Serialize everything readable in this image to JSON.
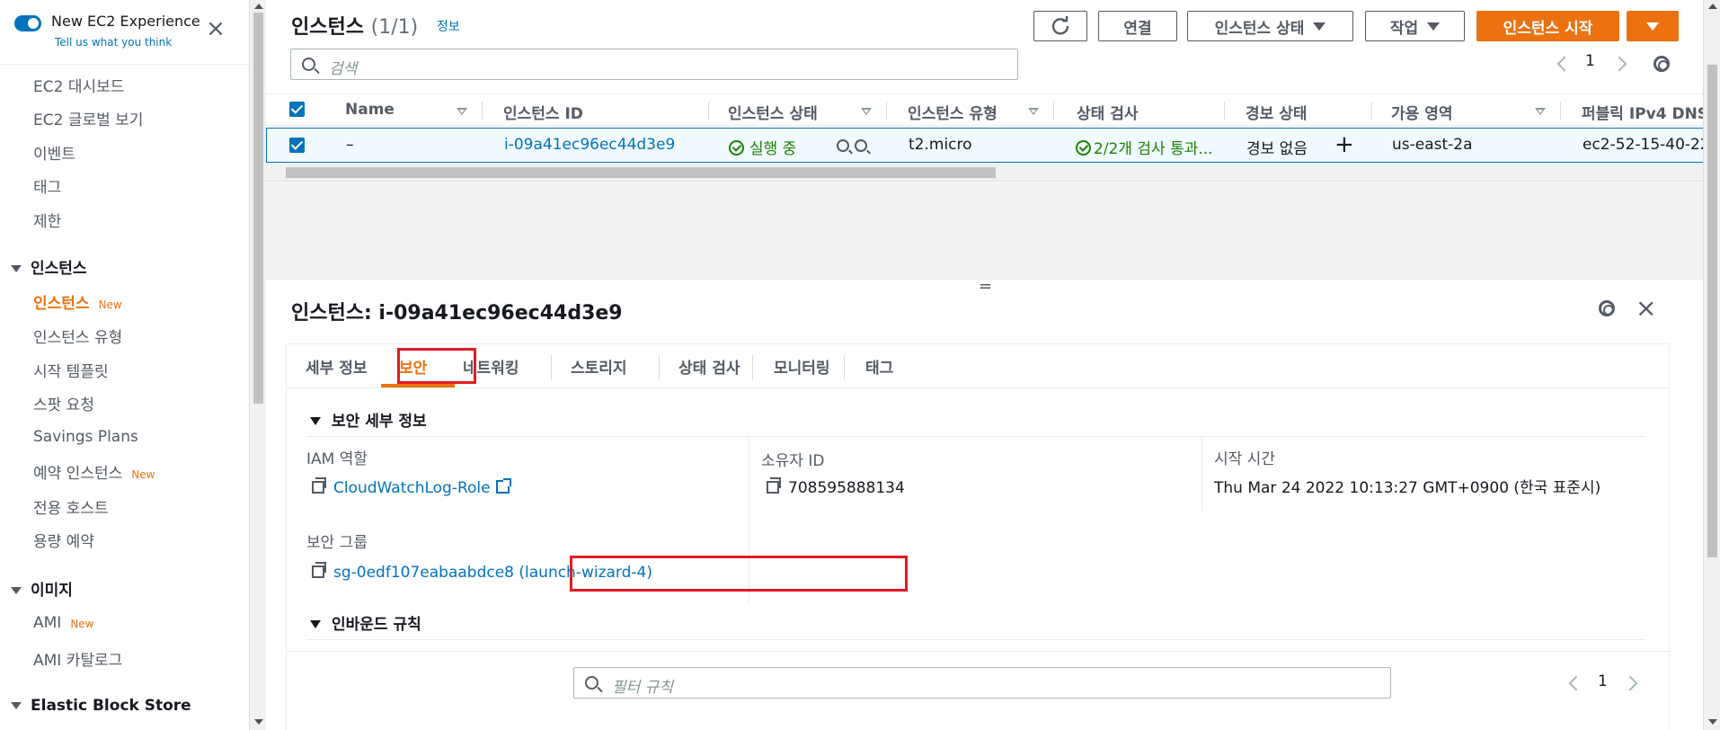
{
  "sidebar": {
    "experience_title": "New EC2 Experience",
    "experience_sub": "Tell us what you think",
    "close_glyph": "×",
    "items": [
      {
        "label": "EC2 대시보드"
      },
      {
        "label": "EC2 글로벌 보기"
      },
      {
        "label": "이벤트"
      },
      {
        "label": "태그"
      },
      {
        "label": "제한"
      }
    ],
    "section_instances": "인스턴스",
    "instances_items": [
      {
        "label": "인스턴스",
        "badge": "New"
      },
      {
        "label": "인스턴스 유형"
      },
      {
        "label": "시작 템플릿"
      },
      {
        "label": "스팟 요청"
      },
      {
        "label": "Savings Plans"
      },
      {
        "label": "예약 인스턴스",
        "badge": "New"
      },
      {
        "label": "전용 호스트"
      },
      {
        "label": "용량 예약"
      }
    ],
    "section_images": "이미지",
    "images_items": [
      {
        "label": "AMI",
        "badge": "New"
      },
      {
        "label": "AMI 카탈로그"
      }
    ],
    "section_ebs": "Elastic Block Store"
  },
  "header": {
    "title": "인스턴스",
    "count": "(1/1)",
    "info": "정보",
    "connect": "연결",
    "state": "인스턴스 상태",
    "actions": "작업",
    "launch": "인스턴스 시작",
    "search_placeholder": "검색",
    "page": "1"
  },
  "table": {
    "columns": [
      "Name",
      "인스턴스 ID",
      "인스턴스 상태",
      "인스턴스 유형",
      "상태 검사",
      "경보 상태",
      "가용 영역",
      "퍼블릭 IPv4 DNS"
    ],
    "row": {
      "name": "–",
      "id": "i-09a41ec96ec44d3e9",
      "state": "실행 중",
      "type": "t2.micro",
      "check": "2/2개 검사 통과...",
      "alarm": "경보 없음",
      "alarm_add": "+",
      "az": "us-east-2a",
      "dns": "ec2-52-15-40-22"
    }
  },
  "detail": {
    "title": "인스턴스: i-09a41ec96ec44d3e9",
    "handle": "=",
    "tabs": [
      "세부 정보",
      "보안",
      "네트워킹",
      "스토리지",
      "상태 검사",
      "모니터링",
      "태그"
    ],
    "active_tab": "보안",
    "security_section": "보안 세부 정보",
    "iam_label": "IAM 역할",
    "iam_value": "CloudWatchLog-Role",
    "owner_label": "소유자 ID",
    "owner_value": "708595888134",
    "launch_label": "시작 시간",
    "launch_value": "Thu Mar 24 2022 10:13:27 GMT+0900 (한국 표준시)",
    "sg_label": "보안 그룹",
    "sg_value": "sg-0edf107eabaabdce8 (launch-wizard-4)",
    "inbound_section": "인바운드 규칙",
    "filter_placeholder": "필터 규칙",
    "page": "1"
  },
  "colors": {
    "accent": "#ec7211",
    "link": "#0073bb",
    "success": "#1d8102",
    "highlight": "#e01b24"
  }
}
